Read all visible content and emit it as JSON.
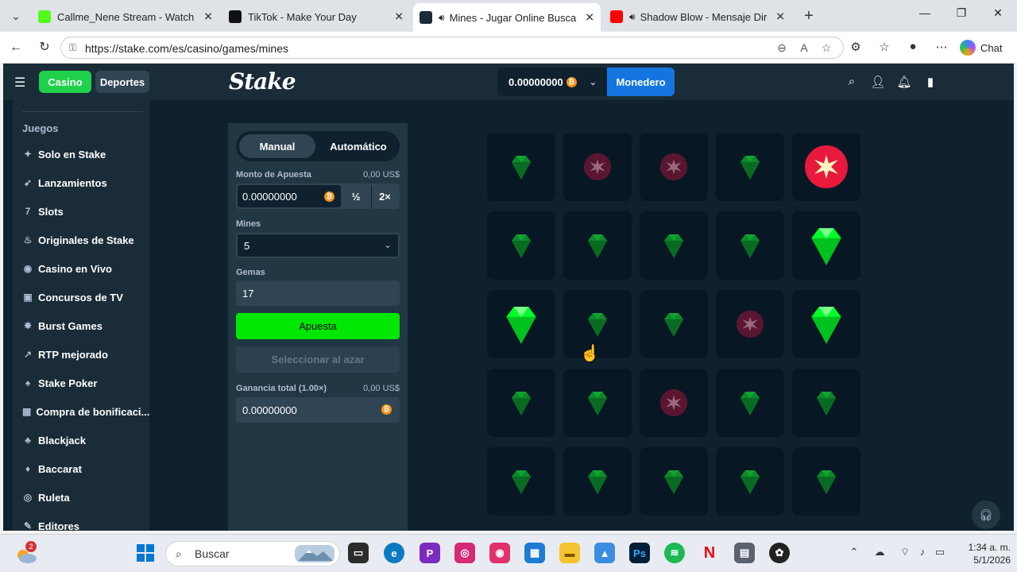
{
  "browser": {
    "tabs": [
      {
        "label": "Callme_Nene Stream - Watch Live",
        "color": "#53fc18",
        "sound": false,
        "active": false
      },
      {
        "label": "TikTok - Make Your Day",
        "color": "#111111",
        "sound": false,
        "active": false
      },
      {
        "label": "Mines - Jugar Online Buscami",
        "color": "#1a2c38",
        "sound": true,
        "active": true
      },
      {
        "label": "Shadow Blow - Mensaje Direc",
        "color": "#ff0000",
        "sound": true,
        "active": false
      }
    ],
    "url": "https://stake.com/es/casino/games/mines",
    "chat_label": "Chat"
  },
  "stake": {
    "logo": "Stake",
    "casino_label": "Casino",
    "sports_label": "Deportes",
    "balance": "0.00000000",
    "wallet_label": "Monedero",
    "accent_color": "#00e701"
  },
  "sidebar": {
    "section_title": "Juegos",
    "items": [
      {
        "label": "Solo en Stake",
        "icon": "star-icon"
      },
      {
        "label": "Lanzamientos",
        "icon": "rocket-icon"
      },
      {
        "label": "Slots",
        "icon": "slots-icon"
      },
      {
        "label": "Originales de Stake",
        "icon": "fire-icon"
      },
      {
        "label": "Casino en Vivo",
        "icon": "live-icon"
      },
      {
        "label": "Concursos de TV",
        "icon": "tv-icon"
      },
      {
        "label": "Burst Games",
        "icon": "burst-icon"
      },
      {
        "label": "RTP mejorado",
        "icon": "rtp-icon"
      },
      {
        "label": "Stake Poker",
        "icon": "poker-icon"
      },
      {
        "label": "Compra de bonificaci...",
        "icon": "gift-icon"
      },
      {
        "label": "Blackjack",
        "icon": "blackjack-icon"
      },
      {
        "label": "Baccarat",
        "icon": "baccarat-icon"
      },
      {
        "label": "Ruleta",
        "icon": "roulette-icon"
      },
      {
        "label": "Editores",
        "icon": "editors-icon"
      }
    ]
  },
  "panel": {
    "mode_manual": "Manual",
    "mode_auto": "Automático",
    "bet_label": "Monto de Apuesta",
    "bet_usd": "0,00 US$",
    "bet_value": "0.00000000",
    "half_label": "½",
    "double_label": "2×",
    "mines_label": "Mines",
    "mines_value": "5",
    "gems_label": "Gemas",
    "gems_value": "17",
    "bet_button": "Apuesta",
    "random_button": "Seleccionar al azar",
    "profit_label": "Ganancia total (1.00×)",
    "profit_usd": "0,00 US$",
    "profit_value": "0.00000000"
  },
  "board": {
    "rows": [
      [
        "gem",
        "mine",
        "mine",
        "gem",
        "mine-hit"
      ],
      [
        "gem",
        "gem",
        "gem",
        "gem",
        "gem-revealed"
      ],
      [
        "gem-revealed",
        "gem",
        "gem",
        "mine",
        "gem-revealed"
      ],
      [
        "gem",
        "gem",
        "mine",
        "gem",
        "gem"
      ],
      [
        "gem",
        "gem",
        "gem",
        "gem",
        "gem"
      ]
    ]
  },
  "taskbar": {
    "search_placeholder": "Buscar",
    "weather_badge": "2",
    "time": "1:34 a. m.",
    "date": "5/1/2026"
  }
}
